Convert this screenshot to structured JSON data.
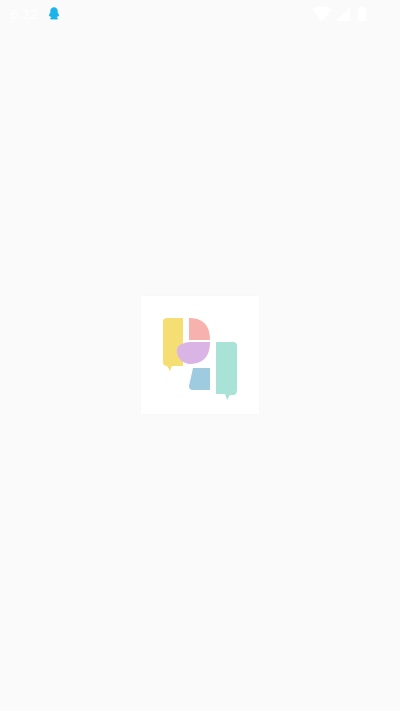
{
  "status_bar": {
    "time": "6:22",
    "notification_icon": "qq-penguin-icon",
    "icons": [
      "wifi-icon",
      "signal-icon",
      "battery-icon"
    ],
    "colors": {
      "notification": "#1ab3ea",
      "system_icons": "#ffffff"
    }
  },
  "splash": {
    "logo": "app-logo-icon",
    "background_color": "#fafafa",
    "card_color": "#ffffff",
    "logo_colors": {
      "yellow": "#f5df74",
      "pink": "#f8b2ad",
      "purple": "#d9b4e4",
      "blue": "#9ecbe0",
      "teal": "#a9e2d6"
    }
  }
}
